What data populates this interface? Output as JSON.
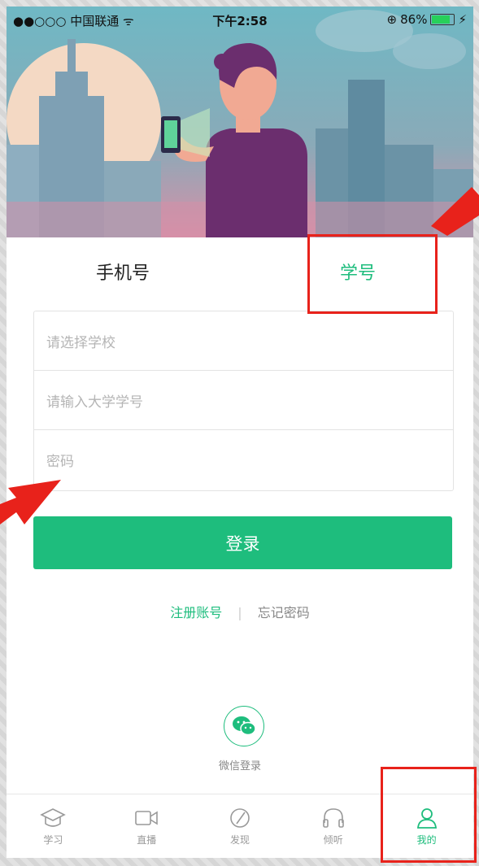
{
  "status_bar": {
    "carrier": "●●○○○ 中国联通 ᯤ",
    "time": "下午2:58",
    "battery_pct": "86%",
    "battery_level": 0.86
  },
  "tabs": {
    "phone": "手机号",
    "student_id": "学号"
  },
  "form": {
    "school_placeholder": "请选择学校",
    "student_id_placeholder": "请输入大学学号",
    "password_placeholder": "密码"
  },
  "login_button": "登录",
  "links": {
    "register": "注册账号",
    "divider": "|",
    "forgot": "忘记密码"
  },
  "wechat": {
    "label": "微信登录"
  },
  "nav": [
    {
      "label": "学习",
      "icon": "graduation-cap-icon"
    },
    {
      "label": "直播",
      "icon": "video-camera-icon"
    },
    {
      "label": "发现",
      "icon": "compass-icon"
    },
    {
      "label": "倾听",
      "icon": "headphones-icon"
    },
    {
      "label": "我的",
      "icon": "person-icon"
    }
  ],
  "colors": {
    "accent": "#1ebd7d",
    "annotation": "#e8221b"
  }
}
